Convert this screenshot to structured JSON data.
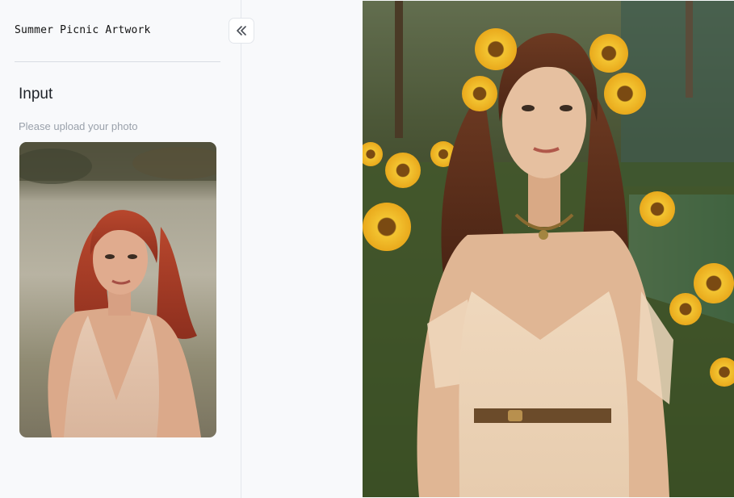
{
  "app": {
    "title": "Summer Picnic Artwork"
  },
  "sidebar": {
    "collapse_icon": "double-chevron-left-icon",
    "input_section": {
      "heading": "Input",
      "hint": "Please upload your photo"
    }
  },
  "images": {
    "input_photo": "red-haired woman in cream dress sitting on field",
    "output_photo": "woman with sunflower crown in sunflower field by water"
  },
  "colors": {
    "background": "#f8f9fb",
    "divider": "#d9dde3",
    "hint_text": "#9aa1ab",
    "heading_text": "#1f2329"
  }
}
